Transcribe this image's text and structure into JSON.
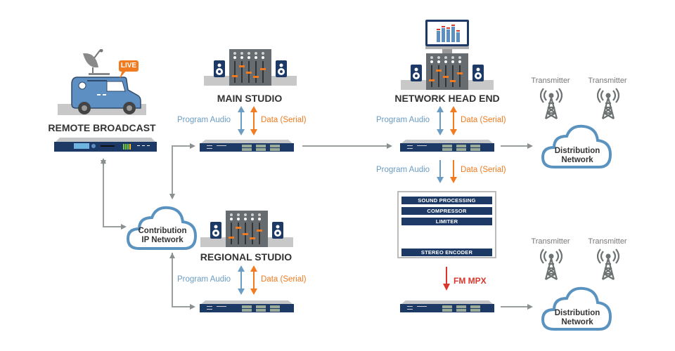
{
  "nodes": {
    "remote_broadcast": {
      "title": "REMOTE BROADCAST",
      "badge": "LIVE"
    },
    "main_studio": {
      "title": "MAIN STUDIO"
    },
    "network_head_end": {
      "title": "NETWORK HEAD END"
    },
    "regional_studio": {
      "title": "REGIONAL STUDIO"
    },
    "contribution_network": {
      "line1": "Contribution",
      "line2": "IP Network"
    },
    "distribution_network_top": {
      "line1": "Distribution",
      "line2": "Network"
    },
    "distribution_network_bottom": {
      "line1": "Distribution",
      "line2": "Network"
    }
  },
  "links": {
    "program_audio": "Program Audio",
    "data_serial": "Data (Serial)",
    "fm_mpx": "FM MPX"
  },
  "transmitters": {
    "top": [
      "Transmitter",
      "Transmitter"
    ],
    "bottom": [
      "Transmitter",
      "Transmitter"
    ]
  },
  "processing_chain": {
    "stages": [
      "SOUND PROCESSING",
      "COMPRESSOR",
      "LIMITER"
    ],
    "encoder": "STEREO ENCODER"
  },
  "colors": {
    "program_audio": "#6a9cc4",
    "data_serial": "#f07b20",
    "fm_mpx": "#d8372b",
    "cloud_stroke": "#5b93c0",
    "device_panel": "#1d3a66",
    "connector": "#999999"
  }
}
